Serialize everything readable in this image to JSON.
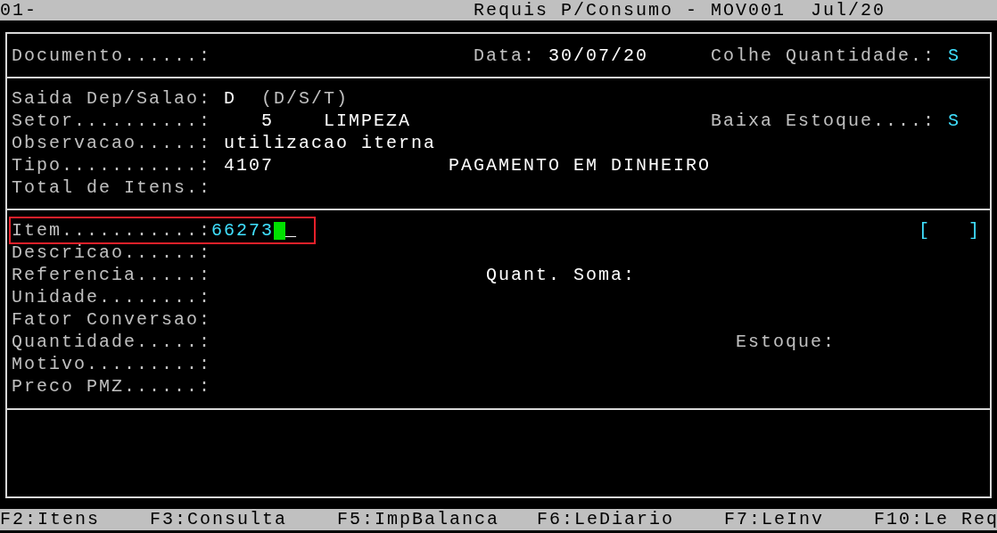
{
  "title_bar": {
    "left": "01-",
    "title": "Requis P/Consumo - MOV001",
    "period": "Jul/20"
  },
  "header": {
    "documento_label": "Documento......:",
    "data_label": "Data:",
    "data_value": "30/07/20",
    "colhe_label": "Colhe Quantidade.:",
    "colhe_value": "S"
  },
  "requisicao": {
    "saida_label": "Saida Dep/Salao:",
    "saida_value": "D",
    "saida_hint": "(D/S/T)",
    "setor_label": "Setor..........:",
    "setor_code": "5",
    "setor_name": "LIMPEZA",
    "baixa_label": "Baixa Estoque....:",
    "baixa_value": "S",
    "observacao_label": "Observacao.....:",
    "observacao_value": "utilizacao iterna",
    "tipo_label": "Tipo...........:",
    "tipo_code": "4107",
    "tipo_name": "PAGAMENTO EM DINHEIRO",
    "total_label": "Total de Itens.:"
  },
  "item": {
    "item_label": "Item...........:",
    "item_value": "66273",
    "focused": true,
    "cursor_tail": "_",
    "bracket_open": "[",
    "bracket_close": "]",
    "descricao_label": "Descricao......:",
    "referencia_label": "Referencia.....:",
    "quant_soma_label": "Quant. Soma:",
    "unidade_label": "Unidade........:",
    "fator_label": "Fator Conversao:",
    "quantidade_label": "Quantidade.....:",
    "estoque_label": "Estoque:",
    "motivo_label": "Motivo.........:",
    "preco_label": "Preco PMZ......:"
  },
  "function_keys": [
    "F2:Itens",
    "F3:Consulta",
    "F5:ImpBalanca",
    "F6:LeDiario",
    "F7:LeInv",
    "F10:Le Req"
  ]
}
